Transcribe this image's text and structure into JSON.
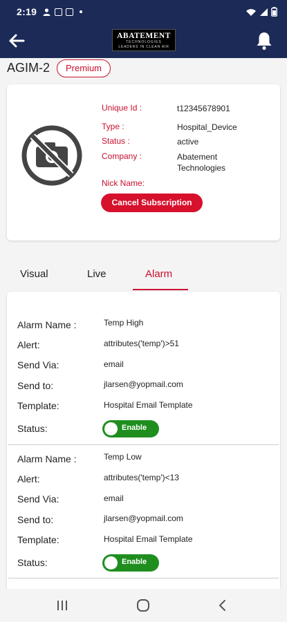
{
  "status_bar": {
    "time": "2:19",
    "icons": [
      "person-icon",
      "image-icon",
      "calendar-icon",
      "wifi-icon",
      "signal-icon",
      "battery-icon"
    ]
  },
  "header": {
    "logo_line1": "ABATEMENT",
    "logo_line2": "TECHNOLOGIES",
    "logo_line3": "LEADERS IN CLEAN AIR",
    "bg_color": "#1c2a57"
  },
  "device": {
    "name": "AGIM-2",
    "badge": "Premium"
  },
  "info": {
    "unique_id_label": "Unique Id :",
    "unique_id": "t12345678901",
    "type_label": "Type :",
    "type": "Hospital_Device",
    "status_label": "Status :",
    "status": "active",
    "company_label": "Company :",
    "company_line1": "Abatement",
    "company_line2": "Technologies",
    "nickname_label": "Nick Name:",
    "cancel_button": "Cancel Subscription",
    "accent_color": "#c8102e"
  },
  "tabs": [
    {
      "label": "Visual",
      "active": false
    },
    {
      "label": "Live",
      "active": false
    },
    {
      "label": "Alarm",
      "active": true
    }
  ],
  "alarm_labels": {
    "name": "Alarm Name :",
    "alert": "Alert:",
    "send_via": "Send Via:",
    "send_to": "Send to:",
    "template": "Template:",
    "status": "Status:"
  },
  "alarms": [
    {
      "name": "Temp High",
      "alert": "attributes('temp')>51",
      "send_via": "email",
      "send_to": "jlarsen@yopmail.com",
      "template": "Hospital Email Template",
      "status": "Enable"
    },
    {
      "name": "Temp Low",
      "alert": "attributes('temp')<13",
      "send_via": "email",
      "send_to": "jlarsen@yopmail.com",
      "template": "Hospital Email Template",
      "status": "Enable"
    }
  ]
}
